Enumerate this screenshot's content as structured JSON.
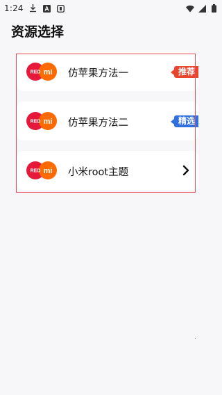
{
  "statusbar": {
    "time": "1:24",
    "icons": [
      "download-icon",
      "a-box-icon",
      "d-box-icon",
      "wifi-icon",
      "cellular-icon",
      "battery-icon"
    ]
  },
  "page": {
    "title": "资源选择"
  },
  "colors": {
    "highlight": "#e24a55",
    "badge_red": "#e8452f",
    "badge_blue": "#2f6fe0",
    "mi_orange": "#ff6a00",
    "redmi_red": "#e7193b"
  },
  "options": [
    {
      "label": "仿苹果方法一",
      "badge": "推荐",
      "badge_color": "red",
      "logo_text": "RED",
      "logo_mi": "mi"
    },
    {
      "label": "仿苹果方法二",
      "badge": "精选",
      "badge_color": "blue",
      "logo_text": "RED",
      "logo_mi": "mi"
    },
    {
      "label": "小米root主题",
      "trailing_icon": "chevron-right-icon",
      "logo_text": "RED",
      "logo_mi": "mi"
    }
  ]
}
